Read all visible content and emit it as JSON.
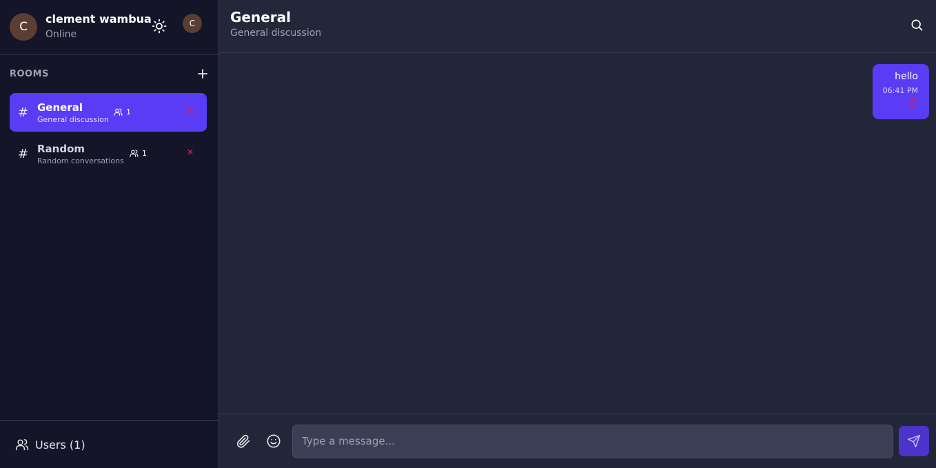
{
  "user": {
    "initial": "C",
    "name": "clement wambua",
    "status": "Online",
    "mini_initial": "C"
  },
  "rooms_section": {
    "title": "ROOMS"
  },
  "rooms": [
    {
      "name": "General",
      "description": "General discussion",
      "members": "1",
      "active": true
    },
    {
      "name": "Random",
      "description": "Random conversations",
      "members": "1",
      "active": false
    }
  ],
  "footer": {
    "users_label": "Users (1)"
  },
  "chat": {
    "title": "General",
    "subtitle": "General discussion"
  },
  "messages": [
    {
      "text": "hello",
      "time": "06:41 PM"
    }
  ],
  "composer": {
    "placeholder": "Type a message..."
  },
  "colors": {
    "accent": "#5b3cf5",
    "danger": "#e11d48",
    "sidebar_bg": "#141528",
    "main_bg": "#222639"
  },
  "icons": {
    "theme": "sun-icon",
    "add": "plus-icon",
    "members": "users-icon",
    "delete": "close-icon",
    "search": "search-icon",
    "attach": "paperclip-icon",
    "emoji": "smile-icon",
    "send": "send-icon",
    "trash": "trash-icon"
  }
}
